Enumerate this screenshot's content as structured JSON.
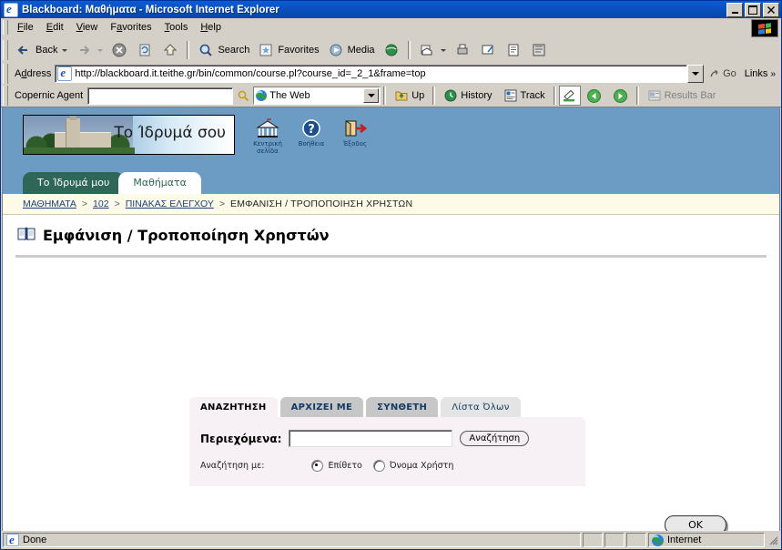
{
  "window": {
    "title": "Blackboard: Μαθήματα - Microsoft Internet Explorer",
    "icon": "ie-document-icon",
    "minimize_label": "_",
    "maximize_label": "□",
    "close_label": "✕"
  },
  "menu": {
    "items": [
      {
        "label": "File",
        "accel": "F"
      },
      {
        "label": "Edit",
        "accel": "E"
      },
      {
        "label": "View",
        "accel": "V"
      },
      {
        "label": "Favorites",
        "accel": "a"
      },
      {
        "label": "Tools",
        "accel": "T"
      },
      {
        "label": "Help",
        "accel": "H"
      }
    ]
  },
  "toolbar": {
    "back_label": "Back",
    "forward_label": "",
    "stop_label": "",
    "refresh_label": "",
    "home_label": "",
    "search_label": "Search",
    "favorites_label": "Favorites",
    "media_label": "Media",
    "history_label": "",
    "mail_label": "",
    "print_label": "",
    "edit_label": "",
    "read_label": "",
    "discuss_label": ""
  },
  "address": {
    "label": "Address",
    "url": "http://blackboard.it.teithe.gr/bin/common/course.pl?course_id=_2_1&frame=top",
    "go_label": "Go",
    "links_label": "Links",
    "links_chevron": "»"
  },
  "copernic": {
    "label": "Copernic Agent",
    "query": "",
    "query_placeholder": "",
    "scope": "The Web",
    "up_label": "Up",
    "history_label": "History",
    "track_label": "Track",
    "results_bar_label": "Results Bar"
  },
  "blackboard": {
    "banner_text": "Το Ίδρυμά σου",
    "header_icons": [
      {
        "name": "home-icon",
        "label": "Κεντρική σελίδα"
      },
      {
        "name": "help-icon",
        "label": "Βοήθεια"
      },
      {
        "name": "logout-icon",
        "label": "Έξοδος"
      }
    ],
    "tabs": [
      {
        "label": "Το Ίδρυμά μου",
        "active": false
      },
      {
        "label": "Μαθήματα",
        "active": true
      }
    ],
    "breadcrumb": {
      "items": [
        "ΜΑΘΗΜΑΤΑ",
        "102",
        "ΠΙΝΑΚΑΣ ΕΛΕΓΧΟΥ"
      ],
      "current": "ΕΜΦΑΝΙΣΗ / ΤΡΟΠΟΠΟΙΗΣΗ ΧΡΗΣΤΩΝ",
      "separator": ">"
    },
    "page_title": "Εμφάνιση / Τροποποίηση Χρηστών",
    "search_panel": {
      "tabs": [
        {
          "label": "ΑΝΑΖΗΤΗΣΗ",
          "state": "active"
        },
        {
          "label": "ΑΡΧΙΖΕΙ ΜΕ",
          "state": "grey"
        },
        {
          "label": "ΣΥΝΘΕΤΗ",
          "state": "grey"
        },
        {
          "label": "Λίστα Όλων",
          "state": "light"
        }
      ],
      "contents_label": "Περιεχόμενα:",
      "contents_value": "",
      "search_button": "Αναζήτηση",
      "search_by_label": "Αναζήτηση με:",
      "radios": [
        {
          "label": "Επίθετο",
          "selected": true
        },
        {
          "label": "Όνομα Χρήστη",
          "selected": false
        }
      ]
    },
    "ok_button": "OK"
  },
  "statusbar": {
    "message": "Done",
    "zone": "Internet"
  },
  "colors": {
    "titlebar": "#0a50c0",
    "chrome": "#d4d0c8",
    "bb_header": "#6c9cc4",
    "bb_tab_inactive": "#2e6658",
    "breadcrumb_bg": "#fdfbe8",
    "panel_bg": "#f7f0f4"
  }
}
